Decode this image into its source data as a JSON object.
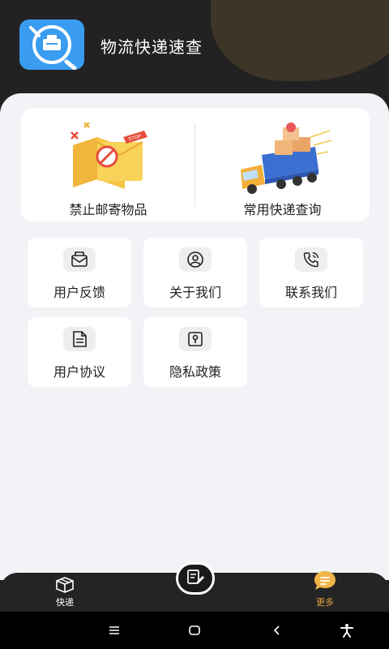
{
  "app": {
    "title": "物流快递速查"
  },
  "features": [
    {
      "label": "禁止邮寄物品",
      "icon": "stop-sign-illustration"
    },
    {
      "label": "常用快递查询",
      "icon": "delivery-truck-illustration"
    }
  ],
  "menu": [
    {
      "label": "用户反馈",
      "icon": "mail-icon"
    },
    {
      "label": "关于我们",
      "icon": "user-icon"
    },
    {
      "label": "联系我们",
      "icon": "phone-icon"
    },
    {
      "label": "用户协议",
      "icon": "document-icon"
    },
    {
      "label": "隐私政策",
      "icon": "lock-icon"
    }
  ],
  "tabbar": {
    "left_label": "快递",
    "right_label": "更多",
    "active": "更多"
  },
  "colors": {
    "accent": "#e3a43a",
    "header_bg": "#222222",
    "content_bg": "#f1f3f6",
    "logo_blue": "#3a9cf0"
  }
}
